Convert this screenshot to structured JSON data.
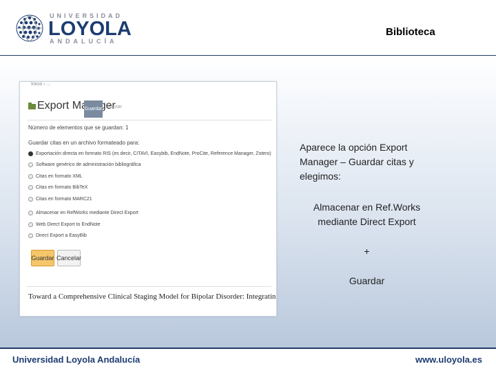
{
  "header": {
    "logo": {
      "top": "UNIVERSIDAD",
      "main": "LOYOLA",
      "bottom": "ANDALUCÍA"
    },
    "section_title": "Biblioteca"
  },
  "screenshot": {
    "breadcrumb": "Inicio › ...",
    "title": "Export Manager",
    "save_button": "Guardar",
    "send_button": "Enviar",
    "item_count": "Número de elementos que se guardan: 1",
    "save_citations_label": "Guardar citas en un archivo formateado para:",
    "options": [
      {
        "label": "Exportación directa en formato RIS (es decir, CITAVI, Easybib, EndNote, ProCite, Reference Manager, Zotero)",
        "selected": true
      },
      {
        "label": "Software genérico de administración bibliográfica",
        "selected": false
      },
      {
        "label": "Citas en formato XML",
        "selected": false
      },
      {
        "label": "Citas en formato BibTeX",
        "selected": false
      },
      {
        "label": "Citas en formato MARC21",
        "selected": false
      },
      {
        "label": "Almacenar en RefWorks mediante Direct Export",
        "selected": false
      },
      {
        "label": "Web Direct Export to EndNote",
        "selected": false
      },
      {
        "label": "Direct Export a EasyBib",
        "selected": false
      }
    ],
    "guardar_button": "Guardar",
    "cancel_button": "Cancelar",
    "article_title": "Toward a Comprehensive Clinical Staging Model for Bipolar Disorder: Integrating the Evidence."
  },
  "content": {
    "description": "Aparece la opción Export Manager – Guardar citas y elegimos:",
    "highlight": "Almacenar en Ref.Works mediante Direct Export",
    "plus": "+",
    "guardar": "Guardar"
  },
  "footer": {
    "left": "Universidad Loyola Andalucía",
    "right": "www.uloyola.es"
  },
  "colors": {
    "brand": "#1d3c72",
    "button_accent": "#f6c66b"
  }
}
